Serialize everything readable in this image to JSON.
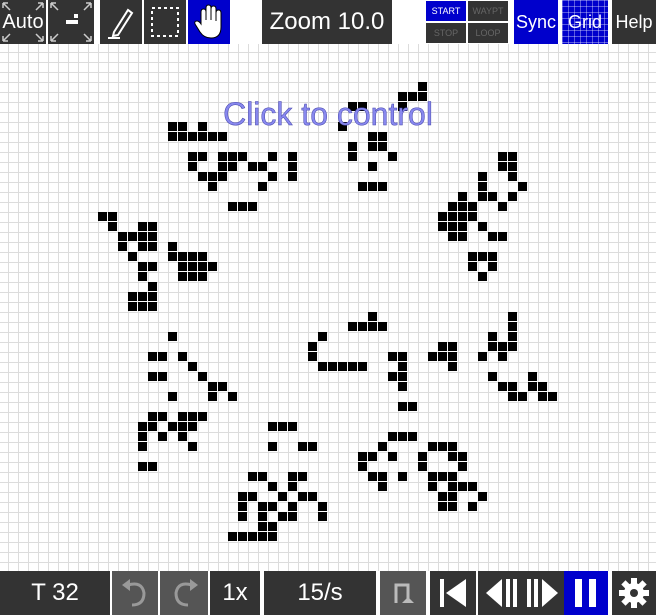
{
  "toolbar_top": {
    "auto_label": "Auto",
    "zoom_label": "Zoom 10.0",
    "start_label": "START",
    "waypt_label": "WAYPT",
    "stop_label": "STOP",
    "loop_label": "LOOP",
    "sync_label": "Sync",
    "grid_label": "Grid",
    "help_label": "Help"
  },
  "canvas": {
    "overlay_text": "Click to control"
  },
  "toolbar_bottom": {
    "time_label": "T 32",
    "speed_label": "1x",
    "rate_label": "15/s"
  },
  "colors": {
    "button_bg": "#333333",
    "active_bg": "#0000cc",
    "cell": "#000000",
    "grid_line": "#dcdcdc"
  }
}
